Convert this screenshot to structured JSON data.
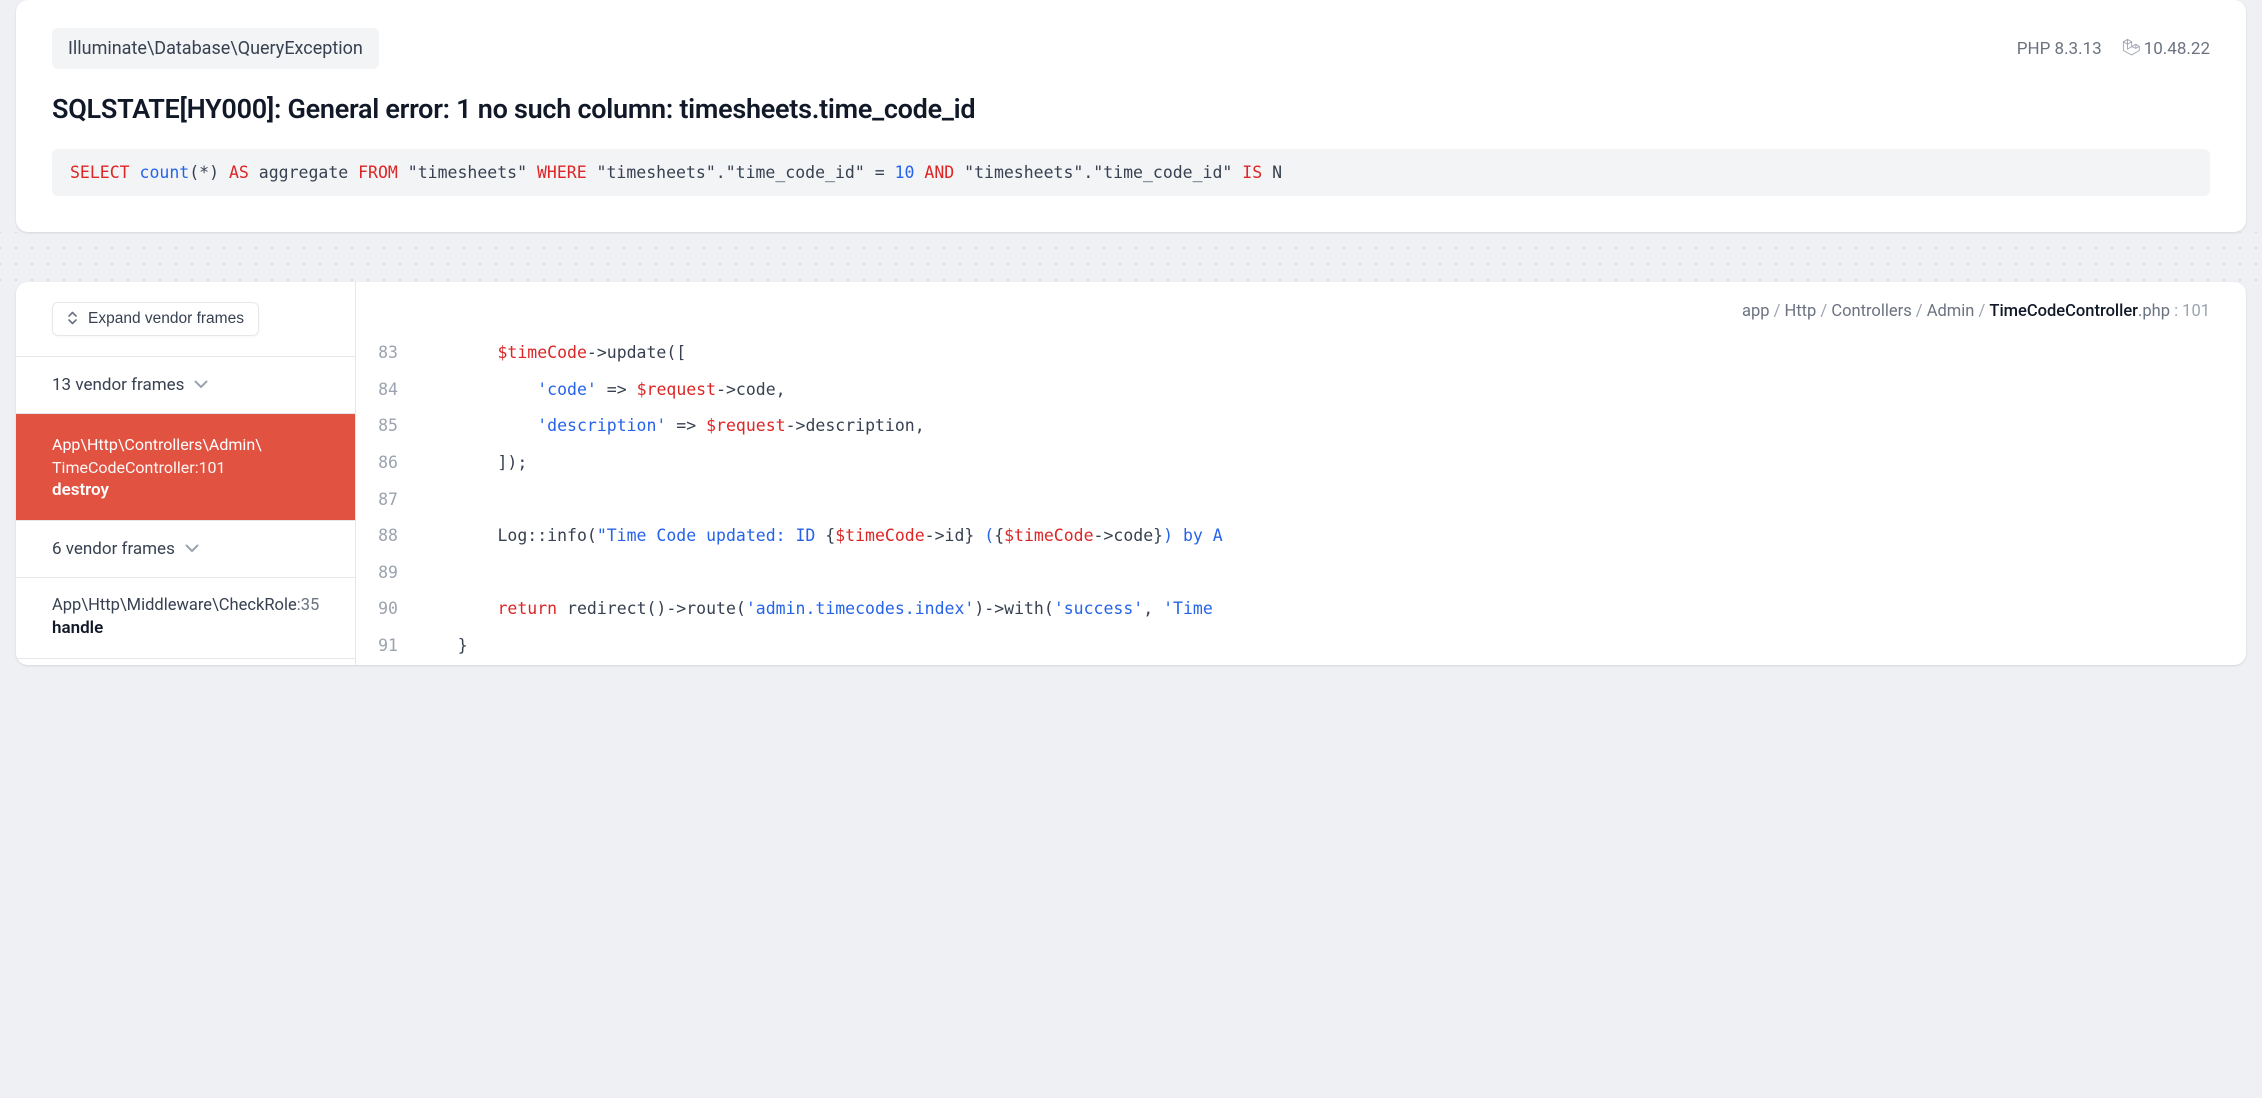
{
  "header": {
    "exception_class": "Illuminate\\Database\\QueryException",
    "php_label": "PHP 8.3.13",
    "laravel_version": "10.48.22",
    "title": "SQLSTATE[HY000]: General error: 1 no such column: timesheets.time_code_id",
    "sql": {
      "tokens": [
        {
          "t": "kw",
          "v": "SELECT "
        },
        {
          "t": "fn",
          "v": "count"
        },
        {
          "t": "plain",
          "v": "(*) "
        },
        {
          "t": "kw",
          "v": "AS"
        },
        {
          "t": "plain",
          "v": " aggregate "
        },
        {
          "t": "kw",
          "v": "FROM"
        },
        {
          "t": "plain",
          "v": " \"timesheets\" "
        },
        {
          "t": "kw",
          "v": "WHERE"
        },
        {
          "t": "plain",
          "v": " \"timesheets\".\"time_code_id\" = "
        },
        {
          "t": "num",
          "v": "10"
        },
        {
          "t": "plain",
          "v": " "
        },
        {
          "t": "kw",
          "v": "AND"
        },
        {
          "t": "plain",
          "v": " \"timesheets\".\"time_code_id\" "
        },
        {
          "t": "kw",
          "v": "IS"
        },
        {
          "t": "plain",
          "v": " N"
        }
      ]
    }
  },
  "frames": {
    "expand_label": "Expand vendor frames",
    "group1": "13 vendor frames",
    "active": {
      "path": "App\\Http\\Controllers\\Admin\\",
      "file": "TimeCodeController",
      "line": "101",
      "method": "destroy"
    },
    "group2": "6 vendor frames",
    "frame2": {
      "path": "App\\Http\\Middleware\\CheckRole",
      "line": "35",
      "method": "handle"
    }
  },
  "code": {
    "path_segments": [
      "app",
      "Http",
      "Controllers",
      "Admin"
    ],
    "file_strong": "TimeCodeController",
    "file_ext": ".php",
    "line": "101",
    "lines": [
      {
        "n": "83",
        "tokens": [
          {
            "t": "plain",
            "v": "        "
          },
          {
            "t": "var",
            "v": "$timeCode"
          },
          {
            "t": "plain",
            "v": "->update(["
          }
        ]
      },
      {
        "n": "84",
        "tokens": [
          {
            "t": "plain",
            "v": "            "
          },
          {
            "t": "str",
            "v": "'code'"
          },
          {
            "t": "plain",
            "v": " => "
          },
          {
            "t": "var",
            "v": "$request"
          },
          {
            "t": "plain",
            "v": "->code,"
          }
        ]
      },
      {
        "n": "85",
        "tokens": [
          {
            "t": "plain",
            "v": "            "
          },
          {
            "t": "str",
            "v": "'description'"
          },
          {
            "t": "plain",
            "v": " => "
          },
          {
            "t": "var",
            "v": "$request"
          },
          {
            "t": "plain",
            "v": "->description,"
          }
        ]
      },
      {
        "n": "86",
        "tokens": [
          {
            "t": "plain",
            "v": "        ]);"
          }
        ]
      },
      {
        "n": "87",
        "tokens": [
          {
            "t": "plain",
            "v": ""
          }
        ]
      },
      {
        "n": "88",
        "tokens": [
          {
            "t": "plain",
            "v": "        Log::info("
          },
          {
            "t": "str",
            "v": "\"Time Code updated: ID "
          },
          {
            "t": "plain",
            "v": "{"
          },
          {
            "t": "var",
            "v": "$timeCode"
          },
          {
            "t": "plain",
            "v": "->id} "
          },
          {
            "t": "str",
            "v": "("
          },
          {
            "t": "plain",
            "v": "{"
          },
          {
            "t": "var",
            "v": "$timeCode"
          },
          {
            "t": "plain",
            "v": "->code}"
          },
          {
            "t": "str",
            "v": ") by A"
          }
        ]
      },
      {
        "n": "89",
        "tokens": [
          {
            "t": "plain",
            "v": ""
          }
        ]
      },
      {
        "n": "90",
        "tokens": [
          {
            "t": "plain",
            "v": "        "
          },
          {
            "t": "kw",
            "v": "return"
          },
          {
            "t": "plain",
            "v": " redirect()->route("
          },
          {
            "t": "str",
            "v": "'admin.timecodes.index'"
          },
          {
            "t": "plain",
            "v": ")->with("
          },
          {
            "t": "str",
            "v": "'success'"
          },
          {
            "t": "plain",
            "v": ", "
          },
          {
            "t": "str",
            "v": "'Time"
          }
        ]
      },
      {
        "n": "91",
        "tokens": [
          {
            "t": "plain",
            "v": "    }"
          }
        ]
      }
    ]
  }
}
